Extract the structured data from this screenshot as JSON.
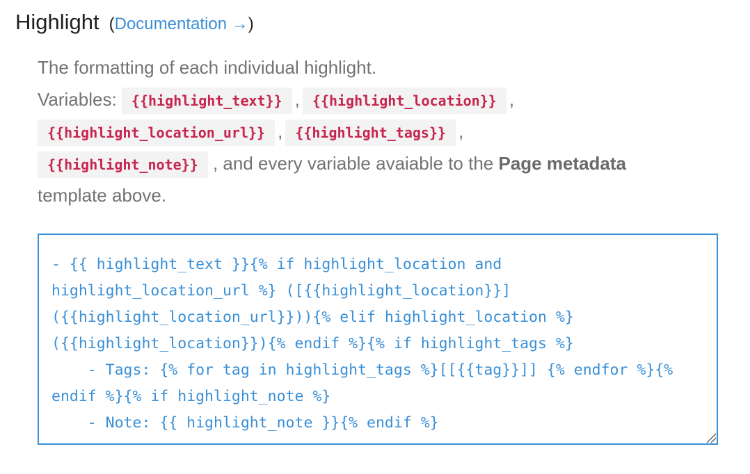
{
  "header": {
    "title": "Highlight",
    "open_paren": "(",
    "doc_link_label": "Documentation →",
    "close_paren": ")"
  },
  "description": {
    "intro": "The formatting of each individual highlight.",
    "variables_label": "Variables:",
    "variables": [
      "{{highlight_text}}",
      "{{highlight_location}}",
      "{{highlight_location_url}}",
      "{{highlight_tags}}",
      "{{highlight_note}}"
    ],
    "separator": ",",
    "tail_text": ", and every variable avaiable to the",
    "tail_bold": "Page metadata",
    "tail_end": "template above."
  },
  "editor": {
    "value": "- {{ highlight_text }}{% if highlight_location and highlight_location_url %} ([{{highlight_location}}]({{highlight_location_url}})){% elif highlight_location %} ({{highlight_location}}){% endif %}{% if highlight_tags %}\n    - Tags: {% for tag in highlight_tags %}[[{{tag}}]] {% endfor %}{% endif %}{% if highlight_note %}\n    - Note: {{ highlight_note }}{% endif %}"
  },
  "colors": {
    "accent": "#3a8fd6",
    "variable_text": "#c7254e",
    "variable_bg": "#f3f3f3",
    "body_text": "#737373"
  },
  "icons": {
    "resize_handle": "resize-handle-icon"
  }
}
